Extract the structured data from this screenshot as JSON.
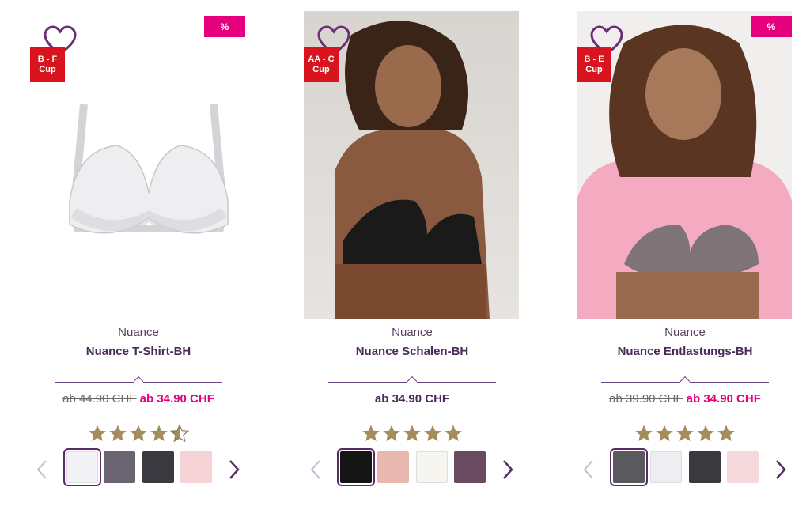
{
  "products": [
    {
      "cup": "B - F\nCup",
      "discount_badge": "%",
      "brand": "Nuance",
      "name": "Nuance T-Shirt-BH",
      "old_price": "ab 44.90 CHF",
      "price": "ab 34.90 CHF",
      "rating": 4.5,
      "swatch_colors": [
        "#f2f2f4",
        "#6a6470",
        "#3a3a40",
        "#f4d2d6"
      ]
    },
    {
      "cup": "AA - C\nCup",
      "discount_badge": "",
      "brand": "Nuance",
      "name": "Nuance Schalen-BH",
      "old_price": "",
      "price": "ab 34.90 CHF",
      "rating": 5,
      "swatch_colors": [
        "#151515",
        "#e8b8b0",
        "#f7f5f0",
        "#6a4a60"
      ]
    },
    {
      "cup": "B - E\nCup",
      "discount_badge": "%",
      "brand": "Nuance",
      "name": "Nuance Entlastungs-BH",
      "old_price": "ab 39.90 CHF",
      "price": "ab 34.90 CHF",
      "rating": 5,
      "swatch_colors": [
        "#5a5a5e",
        "#eeeef2",
        "#3a3a3e",
        "#f5d8dc"
      ]
    }
  ],
  "colors": {
    "accent": "#e6007e",
    "cup_badge": "#d8151f",
    "brand_text": "#4a2b57",
    "star": "#a48c5c"
  }
}
